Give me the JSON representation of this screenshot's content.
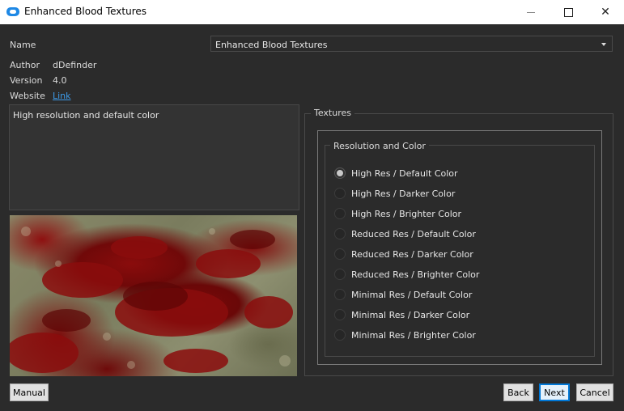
{
  "window": {
    "title": "Enhanced Blood Textures",
    "controls": {
      "minimize": "minimize-icon",
      "maximize": "maximize-icon",
      "close": "close-icon"
    }
  },
  "info": {
    "name_label": "Name",
    "name_value": "Enhanced Blood Textures",
    "author_label": "Author",
    "author_value": "dDefinder",
    "version_label": "Version",
    "version_value": "4.0",
    "website_label": "Website",
    "website_link": "Link"
  },
  "description": "High resolution and default color",
  "textures": {
    "group_title": "Textures",
    "subgroup_title": "Resolution and Color",
    "selected_index": 0,
    "options": [
      "High Res / Default Color",
      "High Res / Darker Color",
      "High Res / Brighter Color",
      "Reduced Res / Default Color",
      "Reduced Res / Darker Color",
      "Reduced Res / Brighter Color",
      "Minimal Res / Default Color",
      "Minimal Res / Darker Color",
      "Minimal Res / Brighter Color"
    ]
  },
  "buttons": {
    "manual": "Manual",
    "back": "Back",
    "next": "Next",
    "cancel": "Cancel"
  },
  "colors": {
    "background": "#2b2b2b",
    "link": "#3d9be9",
    "accent": "#0078d7",
    "blood": "#7a0a0a"
  }
}
